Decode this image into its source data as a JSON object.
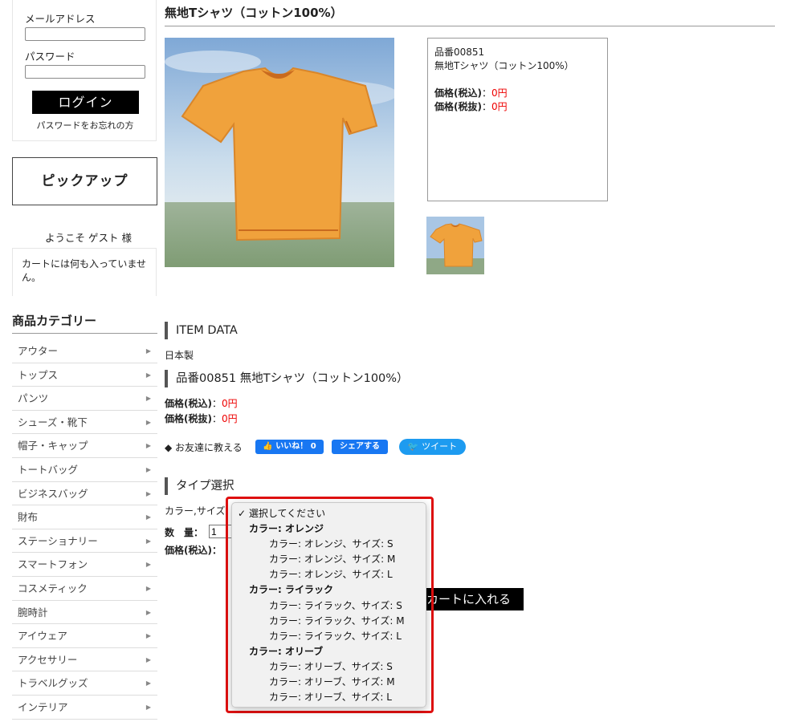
{
  "login": {
    "email_label": "メールアドレス",
    "password_label": "パスワード",
    "login_button": "ログイン",
    "forgot_link": "パスワードをお忘れの方"
  },
  "sidebar": {
    "pickup": "ピックアップ",
    "welcome": "ようこそ ゲスト 様",
    "cart_message": "カートには何も入っていません。",
    "category_title": "商品カテゴリー",
    "categories": [
      "アウター",
      "トップス",
      "パンツ",
      "シューズ・靴下",
      "帽子・キャップ",
      "トートバッグ",
      "ビジネスバッグ",
      "財布",
      "ステーショナリー",
      "スマートフォン",
      "コスメティック",
      "腕時計",
      "アイウェア",
      "アクセサリー",
      "トラベルグッズ",
      "インテリア"
    ]
  },
  "product": {
    "title": "無地Tシャツ（コットン100%）",
    "code": "品番00851",
    "name": "無地Tシャツ（コットン100%）",
    "price_incl_label": "価格(税込)",
    "price_excl_label": "価格(税抜)",
    "colon": "：",
    "price_incl": "0円",
    "price_excl": "0円",
    "item_data_heading": "ITEM DATA",
    "origin": "日本製",
    "code_name_heading": "品番00851 無地Tシャツ（コットン100%）",
    "share_label": "◆ お友達に教える",
    "like_button": "いいね！ 0",
    "share_button": "シェアする",
    "tweet_button": "ツイート",
    "type_heading": "タイプ選択",
    "variant_label": "カラー,サイズ",
    "qty_label": "数　量：",
    "qty_value": "1",
    "price_row_label": "価格(税込)：",
    "add_to_cart": "カートに入れる"
  },
  "dropdown": {
    "selected": "✓ 選択してください",
    "groups": [
      {
        "label": "カラー: オレンジ",
        "options": [
          "カラー: オレンジ、サイズ: S",
          "カラー: オレンジ、サイズ: M",
          "カラー: オレンジ、サイズ: L"
        ]
      },
      {
        "label": "カラー: ライラック",
        "options": [
          "カラー: ライラック、サイズ: S",
          "カラー: ライラック、サイズ: M",
          "カラー: ライラック、サイズ: L"
        ]
      },
      {
        "label": "カラー: オリーブ",
        "options": [
          "カラー: オリーブ、サイズ: S",
          "カラー: オリーブ、サイズ: M",
          "カラー: オリーブ、サイズ: L"
        ]
      }
    ]
  },
  "colors": {
    "accent_red": "#e00000",
    "facebook": "#1877f2",
    "twitter": "#1d9bf0",
    "tshirt": "#f0a23c"
  }
}
